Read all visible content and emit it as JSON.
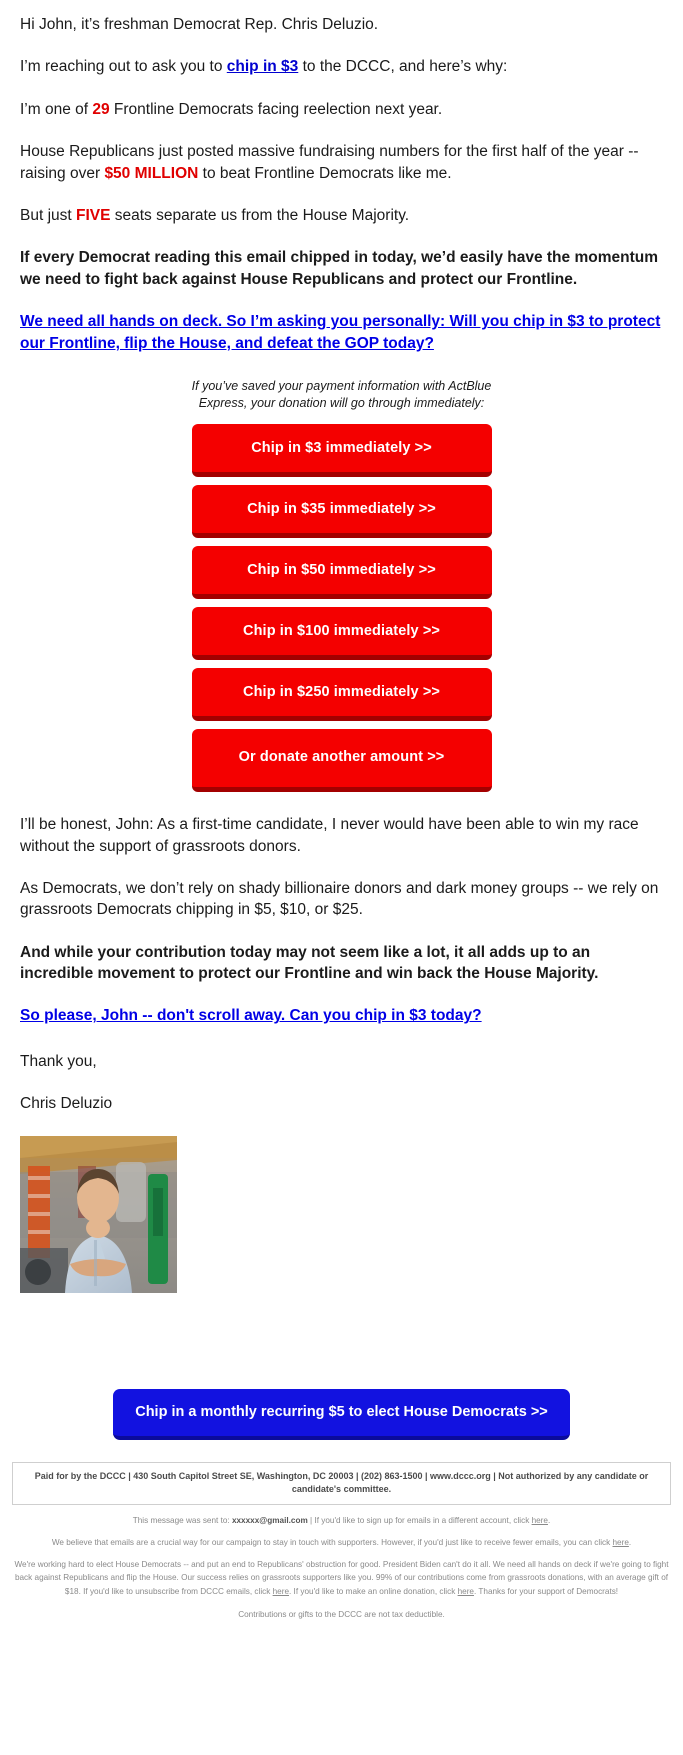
{
  "email": {
    "greeting_prefix": "Hi John, it’s freshman Democrat Rep. Chris Deluzio.",
    "p2_before": "I’m reaching out to ask you to ",
    "p2_link": "chip in $3",
    "p2_after": " to the DCCC, and here’s why:",
    "p3_before": "I’m one of ",
    "p3_red": "29",
    "p3_after": " Frontline Democrats facing reelection next year.",
    "p4_before": "House Republicans just posted massive fundraising numbers for the first half of the year -- raising over ",
    "p4_red": "$50 MILLION",
    "p4_after": " to beat Frontline Democrats like me.",
    "p5_before": "But just ",
    "p5_red": "FIVE",
    "p5_after": " seats separate us from the House Majority.",
    "p6_bold": "If every Democrat reading this email chipped in today, we’d easily have the momentum we need to fight back against House Republicans and protect our Frontline.",
    "p7_link": "We need all hands on deck. So I’m asking you personally: Will you chip in $3 to protect our Frontline, flip the House, and defeat the GOP today?",
    "actblue_note": "If you’ve saved your payment information with ActBlue Express, your donation will go through immediately:",
    "p8": "I’ll be honest, John: As a first-time candidate, I never would have been able to win my race without the support of grassroots donors.",
    "p9": "As Democrats, we don’t rely on shady billionaire donors and dark money groups -- we rely on grassroots Democrats chipping in $5, $10, or $25.",
    "p10_bold": "And while your contribution today may not seem like a lot, it all adds up to an incredible movement to protect our Frontline and win back the House Majority.",
    "p11_link": "So please, John -- don't scroll away. Can you chip in $3 today?",
    "signoff": "Thank you,",
    "signature_name": "Chris Deluzio"
  },
  "donate_buttons": [
    {
      "label": "Chip in $3 immediately >>"
    },
    {
      "label": "Chip in $35 immediately >>"
    },
    {
      "label": "Chip in $50 immediately >>"
    },
    {
      "label": "Chip in $100 immediately >>"
    },
    {
      "label": "Chip in $250 immediately >>"
    },
    {
      "label": "Or donate another amount >>"
    }
  ],
  "cta": {
    "label": "Chip in a monthly recurring $5 to elect House Democrats >>"
  },
  "footer": {
    "paid_for": "Paid for by the DCCC | 430 South Capitol Street SE, Washington, DC 20003 | (202) 863-1500 | www.dccc.org | Not authorized by any candidate or candidate's committee.",
    "sent_to_prefix": "This message was sent to: ",
    "sent_to_email": "xxxxxx@gmail.com",
    "sent_to_suffix_before": " | If you'd like to sign up for emails in a different account, click ",
    "sent_to_link": "here",
    "sent_to_end": ".",
    "fewer_before": "We believe that emails are a crucial way for our campaign to stay in touch with supporters. However, if you'd just like to receive fewer emails, you can click ",
    "fewer_link": "here",
    "fewer_end": ".",
    "block_part1": "We're working hard to elect House Democrats -- and put an end to Republicans' obstruction for good. President Biden can't do it all. We need all hands on deck if we're going to fight back against Republicans and flip the House. Our success relies on grassroots supporters like you. 99% of our contributions come from grassroots donations, with an average gift of $18. If you'd like to unsubscribe from DCCC emails, click ",
    "block_link1": "here",
    "block_part2": ". If you'd like to make an online donation, click ",
    "block_link2": "here",
    "block_part3": ". Thanks for your support of Democrats!",
    "tax_line": "Contributions or gifts to the DCCC are not tax deductible."
  },
  "colors": {
    "donate_red": "#f40000",
    "donate_red_shadow": "#a30000",
    "cta_blue": "#1212e0",
    "link_blue": "#0000e6",
    "emphasis_red": "#e00000"
  },
  "photo": {
    "alt": "Chris Deluzio standing with arms crossed in a workshop"
  }
}
